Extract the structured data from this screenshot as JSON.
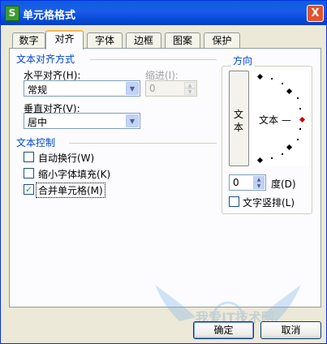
{
  "window": {
    "title": "单元格格式",
    "icon_letter": "S",
    "close_label": "X"
  },
  "tabs": [
    {
      "label": "数字"
    },
    {
      "label": "对齐"
    },
    {
      "label": "字体"
    },
    {
      "label": "边框"
    },
    {
      "label": "图案"
    },
    {
      "label": "保护"
    }
  ],
  "alignment": {
    "group_label": "文本对齐方式",
    "horizontal_label": "水平对齐(H):",
    "horizontal_value": "常规",
    "indent_label": "缩进(I):",
    "indent_value": "0",
    "vertical_label": "垂直对齐(V):",
    "vertical_value": "居中"
  },
  "text_control": {
    "group_label": "文本控制",
    "wrap_label": "自动换行(W)",
    "wrap_checked": false,
    "shrink_label": "缩小字体填充(K)",
    "shrink_checked": false,
    "merge_label": "合并单元格(M)",
    "merge_checked": true
  },
  "orientation": {
    "group_label": "方向",
    "vertical_text_chars": [
      "文",
      "本"
    ],
    "dial_text": "文本 —",
    "degrees_value": "0",
    "degrees_label": "度(D)",
    "vertical_arrange_label": "文字竖排(L)",
    "vertical_arrange_checked": false
  },
  "buttons": {
    "ok": "确定",
    "cancel": "取消"
  },
  "watermark": {
    "text": "我爱IT技术网"
  },
  "colors": {
    "accent": "#0046d5",
    "title_bar": "#0a5fe0",
    "dial_marker": "#cc0000"
  }
}
